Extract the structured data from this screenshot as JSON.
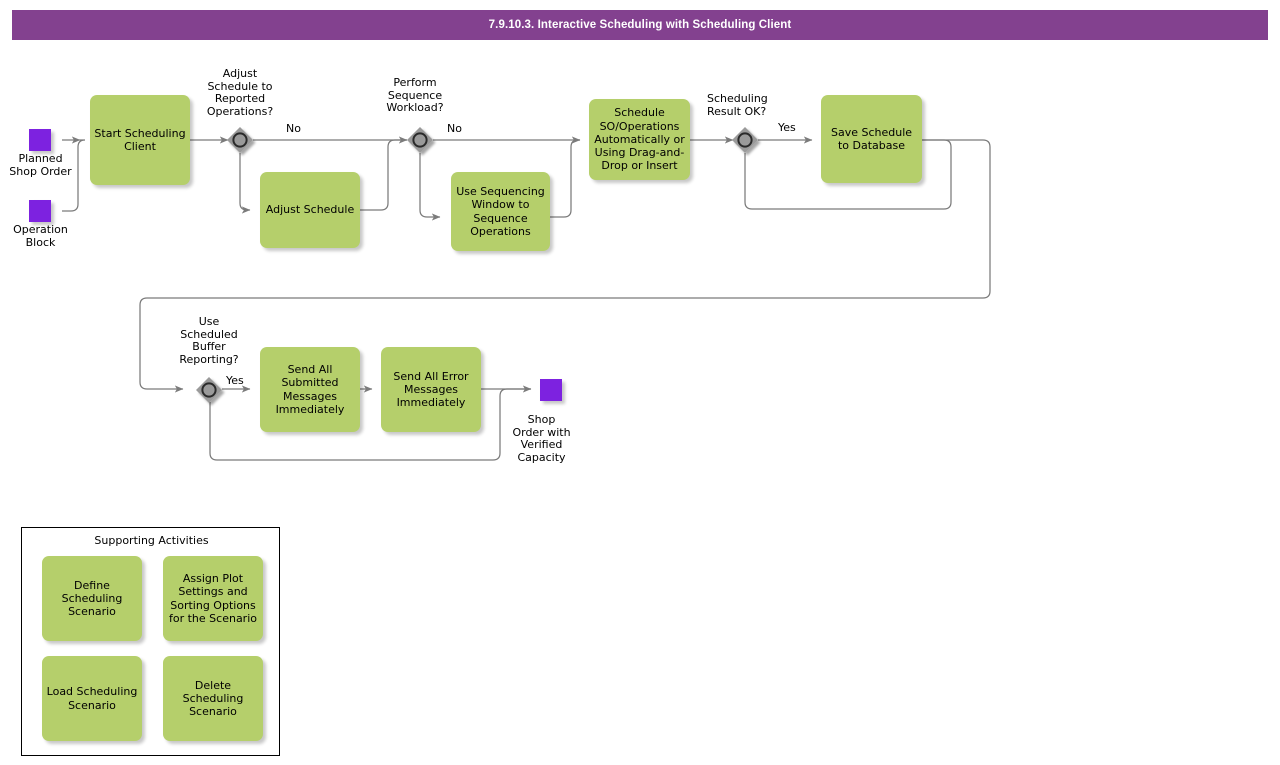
{
  "header": {
    "title": "7.9.10.3. Interactive Scheduling with Scheduling Client",
    "bar_color": "#83418f",
    "text_color": "#ffffff"
  },
  "palette": {
    "process_fill": "#b5cf6b",
    "terminal_fill": "#7d22e0",
    "gateway_fill": "#9a9a9a",
    "connector": "#808080",
    "panel_border": "#000000"
  },
  "terminals": [
    {
      "id": "planned-shop-order",
      "label": "Planned\nShop Order"
    },
    {
      "id": "operation-block",
      "label": "Operation\nBlock"
    },
    {
      "id": "shop-order-verified",
      "label": "Shop\nOrder with\nVerified\nCapacity"
    }
  ],
  "gateways": [
    {
      "id": "adjust-schedule-gw",
      "label": "Adjust\nSchedule to\nReported\nOperations?",
      "branch": "No"
    },
    {
      "id": "perform-sequence-gw",
      "label": "Perform\nSequence\nWorkload?",
      "branch": "No"
    },
    {
      "id": "scheduling-result-gw",
      "label": "Scheduling\nResult OK?",
      "branch": "Yes"
    },
    {
      "id": "buffer-reporting-gw",
      "label": "Use\nScheduled\nBuffer\nReporting?",
      "branch": "Yes"
    }
  ],
  "processes": [
    {
      "id": "start-scheduling-client",
      "label": "Start Scheduling\nClient"
    },
    {
      "id": "adjust-schedule",
      "label": "Adjust Schedule"
    },
    {
      "id": "use-sequencing-window",
      "label": "Use Sequencing\nWindow to\nSequence\nOperations"
    },
    {
      "id": "schedule-so-operations",
      "label": "Schedule\nSO/Operations\nAutomatically or\nUsing Drag-and-\nDrop or Insert"
    },
    {
      "id": "save-schedule-to-database",
      "label": "Save Schedule\nto Database"
    },
    {
      "id": "send-submitted-messages",
      "label": "Send All\nSubmitted\nMessages\nImmediately"
    },
    {
      "id": "send-error-messages",
      "label": "Send All Error\nMessages\nImmediately"
    }
  ],
  "supporting": {
    "title": "Supporting Activities",
    "items": [
      {
        "id": "define-scheduling-scenario",
        "label": "Define\nScheduling\nScenario"
      },
      {
        "id": "assign-plot-settings",
        "label": "Assign Plot\nSettings and\nSorting Options\nfor the Scenario"
      },
      {
        "id": "load-scheduling-scenario",
        "label": "Load Scheduling\nScenario"
      },
      {
        "id": "delete-scheduling-scenario",
        "label": "Delete\nScheduling\nScenario"
      }
    ]
  }
}
